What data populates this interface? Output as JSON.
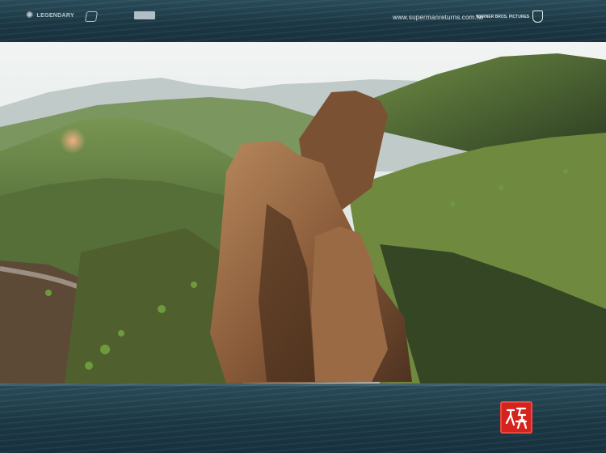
{
  "header": {
    "logos": {
      "legendary": {
        "name": "LEGENDARY",
        "icon": "legendary-sun-icon"
      },
      "bad_robot": {
        "icon": "bad-robot-logo-icon"
      },
      "peters": {
        "icon": "studio-logo-icon"
      }
    },
    "website": "www.supermanreturns.com.tw",
    "distributor": {
      "name": "WARNER BROS. PICTURES",
      "icon": "wb-shield-icon"
    }
  },
  "photo": {
    "subject": "landscape-photo",
    "colors": {
      "sky": "#e6ecee",
      "far_hills": "#b9c6c8",
      "green_hills": "#5e7a3c",
      "rock": "#7a5233",
      "shadow": "#1f2a1c"
    }
  },
  "footer": {
    "seal": {
      "icon": "red-seal-stamp",
      "color": "#d7231e"
    }
  }
}
